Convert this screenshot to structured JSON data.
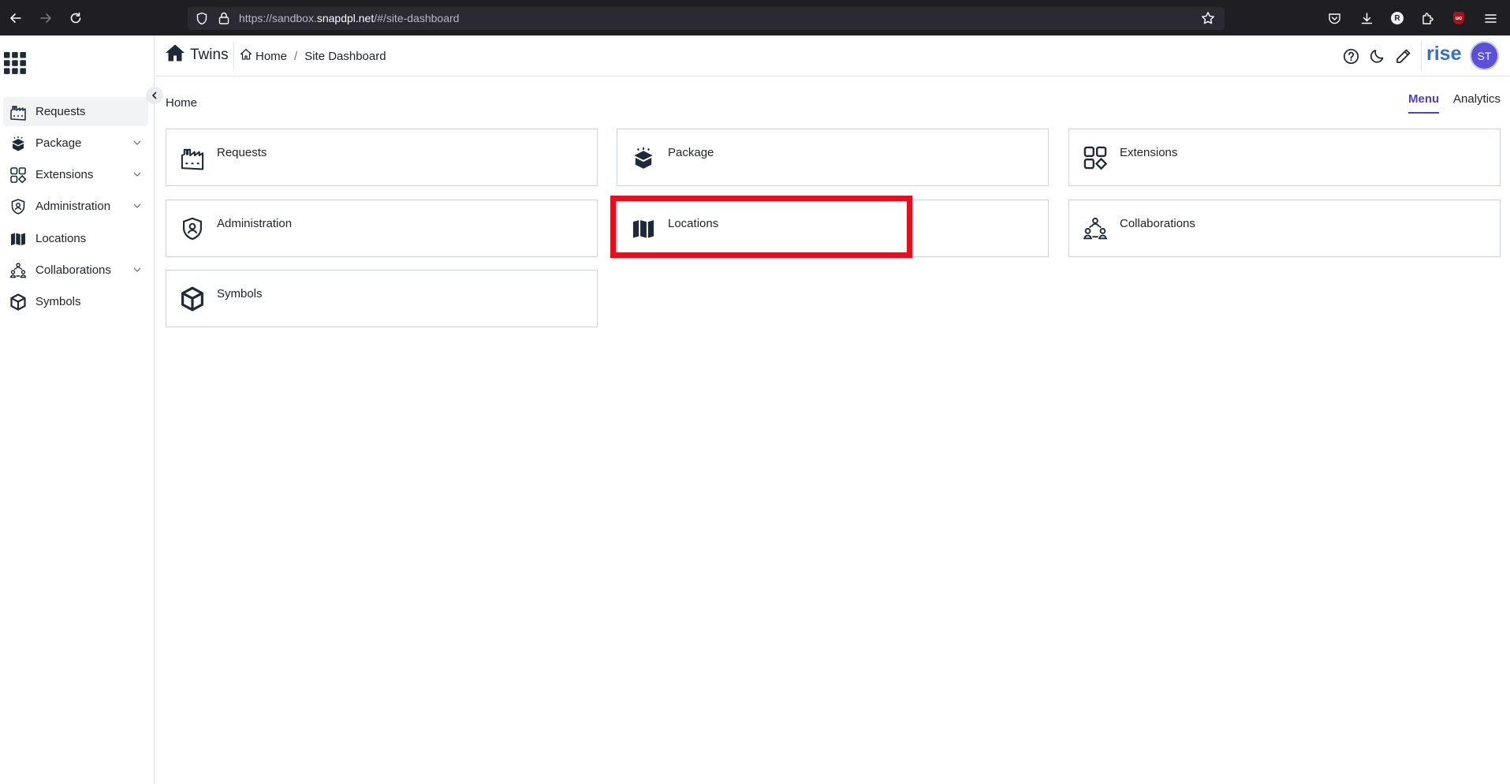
{
  "browser": {
    "url_prefix": "https://sandbox.",
    "url_host": "snapdpl.net",
    "url_suffix": "/#/site-dashboard",
    "profile_initial": "R",
    "ublock_label": "uo"
  },
  "topbar": {
    "app_name": "Twins",
    "breadcrumb": [
      "Home",
      "Site Dashboard"
    ],
    "breadcrumb_sep": "/",
    "brand": "rise",
    "user_initials": "ST"
  },
  "sidebar": {
    "items": [
      {
        "label": "Requests",
        "icon": "factory-icon",
        "expandable": false,
        "active": true
      },
      {
        "label": "Package",
        "icon": "package-open-icon",
        "expandable": true,
        "active": false
      },
      {
        "label": "Extensions",
        "icon": "apps-shapes-icon",
        "expandable": true,
        "active": false
      },
      {
        "label": "Administration",
        "icon": "shield-user-icon",
        "expandable": true,
        "active": false
      },
      {
        "label": "Locations",
        "icon": "map-book-icon",
        "expandable": false,
        "active": false
      },
      {
        "label": "Collaborations",
        "icon": "collaboration-icon",
        "expandable": true,
        "active": false
      },
      {
        "label": "Symbols",
        "icon": "cube-icon",
        "expandable": false,
        "active": false
      }
    ]
  },
  "main": {
    "title": "Home",
    "tabs": [
      {
        "label": "Menu",
        "active": true
      },
      {
        "label": "Analytics",
        "active": false
      }
    ],
    "cards": [
      {
        "label": "Requests",
        "icon": "factory-icon"
      },
      {
        "label": "Package",
        "icon": "package-open-icon"
      },
      {
        "label": "Extensions",
        "icon": "apps-shapes-icon"
      },
      {
        "label": "Administration",
        "icon": "shield-user-icon"
      },
      {
        "label": "Locations",
        "icon": "map-book-icon"
      },
      {
        "label": "Collaborations",
        "icon": "collaboration-icon"
      },
      {
        "label": "Symbols",
        "icon": "cube-icon"
      }
    ]
  },
  "colors": {
    "accent": "#4c3fc9",
    "highlight": "#e3101f",
    "brand": "#2f6fd6",
    "avatar": "#5b51d8"
  }
}
